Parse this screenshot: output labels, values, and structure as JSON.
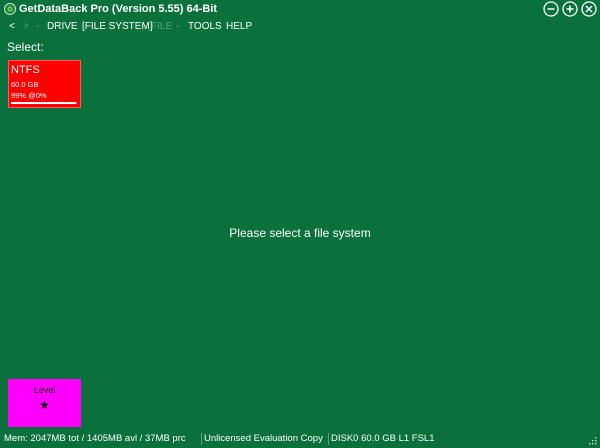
{
  "window": {
    "title": "GetDataBack Pro (Version 5.55) 64-Bit",
    "controls": [
      "minimize-icon",
      "maximize-icon",
      "close-icon"
    ]
  },
  "menu": {
    "back": "<",
    "forward": ">",
    "sep": "-",
    "drive": "DRIVE",
    "file_system": "[FILE SYSTEM]",
    "file": "FILE",
    "tools": "TOOLS",
    "help": "HELP"
  },
  "main": {
    "select_label": "Select:",
    "message": "Please select a file system"
  },
  "fs_tile": {
    "name": "NTFS",
    "size": "60.0 GB",
    "stat": "99% @0%",
    "progress": 0.99,
    "color": "#ff0000"
  },
  "level_tile": {
    "label": "Level",
    "star": "★",
    "color": "#ff00ff"
  },
  "status": {
    "mem": "Mem: 2047MB tot / 1405MB avl / 37MB prc",
    "license": "Unlicensed Evaluation Copy",
    "disk": "DISK0 60.0 GB L1 FSL1"
  },
  "colors": {
    "background": "#0a703c",
    "dim_text": "#5aa27c"
  }
}
